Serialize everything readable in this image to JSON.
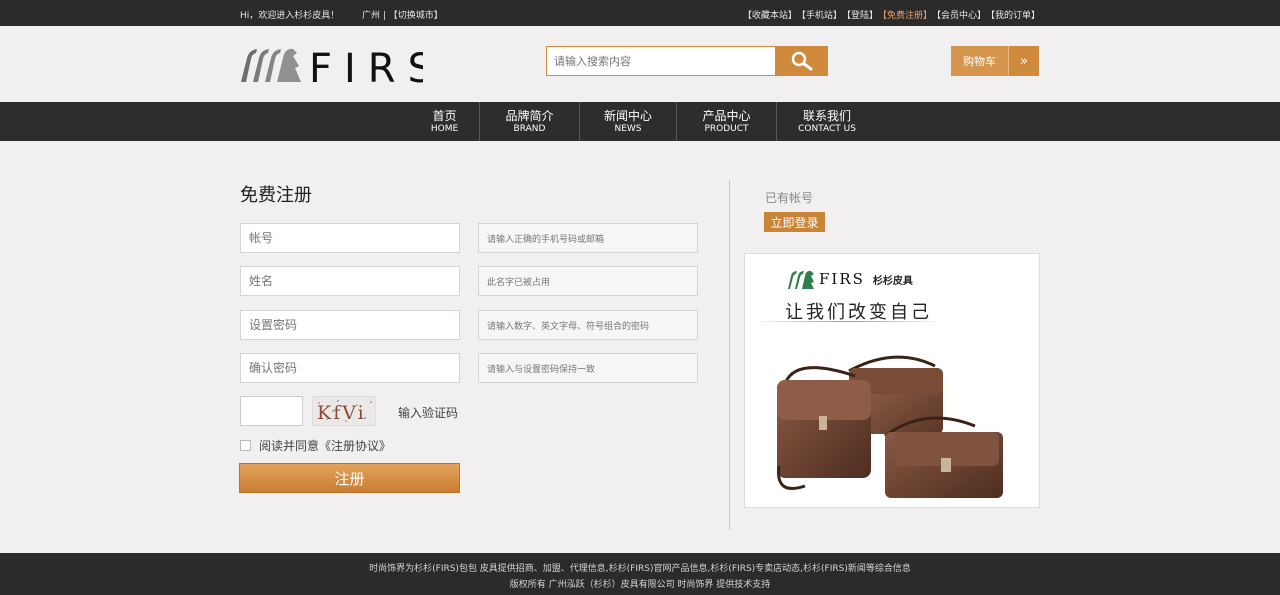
{
  "topbar": {
    "welcome": "Hi，欢迎进入杉杉皮具！",
    "city": "广州 | 【切换城市】",
    "links": [
      "【收藏本站】",
      "【手机站】",
      "【登陆】",
      "【免费注册】",
      "【会员中心】",
      "【我的订单】"
    ],
    "active_link_index": 3
  },
  "header": {
    "logo_text": "FIRS",
    "search_placeholder": "请输入搜索内容",
    "cart_label": "购物车",
    "cart_arrow": "»"
  },
  "nav": [
    {
      "cn": "首页",
      "en": "HOME"
    },
    {
      "cn": "品牌简介",
      "en": "BRAND"
    },
    {
      "cn": "新闻中心",
      "en": "NEWS"
    },
    {
      "cn": "产品中心",
      "en": "PRODUCT"
    },
    {
      "cn": "联系我们",
      "en": "CONTACT US"
    }
  ],
  "register": {
    "title": "免费注册",
    "fields": [
      {
        "placeholder": "帐号",
        "hint": "请输入正确的手机号码或邮箱"
      },
      {
        "placeholder": "姓名",
        "hint": "此名字已被占用"
      },
      {
        "placeholder": "设置密码",
        "hint": "请输入数字、英文字母、符号组合的密码"
      },
      {
        "placeholder": "确认密码",
        "hint": "请输入与设置密码保持一致"
      }
    ],
    "captcha_text": "KfVi",
    "captcha_label": "输入验证码",
    "agree_text": "阅读并同意《注册协议》",
    "submit_label": "注册"
  },
  "side": {
    "have_account": "已有帐号",
    "login_label": "立即登录",
    "promo_brand": "FIRS",
    "promo_brand_cn": "杉杉皮具",
    "promo_slogan": "让我们改变自己"
  },
  "footer": {
    "line1": "时尚饰界为杉杉(FIRS)包包 皮具提供招商、加盟、代理信息,杉杉(FIRS)官网产品信息,杉杉(FIRS)专卖店动态,杉杉(FIRS)新闻等综合信息",
    "line2": "版权所有   广州泓跃（杉杉）皮具有限公司   时尚饰界   提供技术支持"
  },
  "colors": {
    "accent": "#d08a3c",
    "dark_bar": "#2b2b2b",
    "background": "#f1eff0",
    "active_link": "#e8a26a"
  }
}
